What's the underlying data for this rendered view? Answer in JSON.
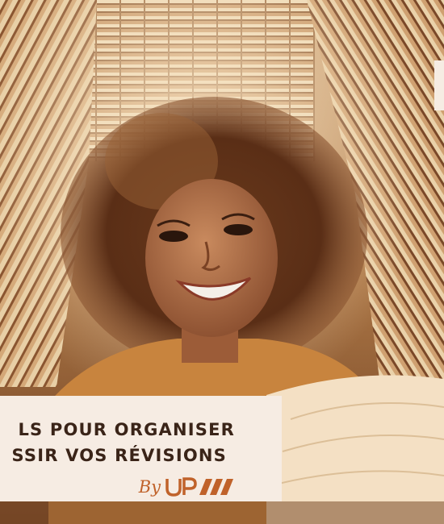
{
  "caption": {
    "line1": "LS POUR ORGANISER",
    "line2": "SSIR VOS RÉVISIONS",
    "by": "By"
  },
  "logo": {
    "brand": "UP",
    "color": "#c0622a"
  },
  "colors": {
    "caption_bg": "#f6ece3",
    "caption_text": "#3a2418",
    "accent": "#c0622a"
  }
}
